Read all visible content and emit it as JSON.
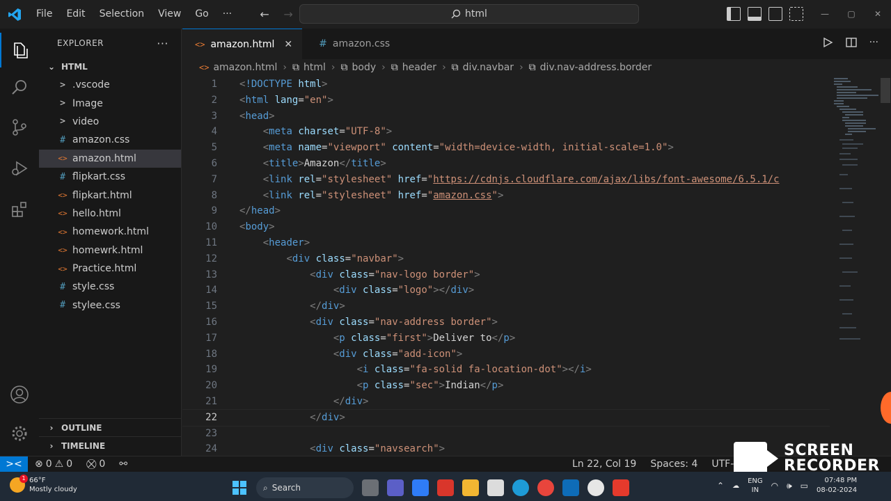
{
  "titlebar": {
    "menu": [
      "File",
      "Edit",
      "Selection",
      "View",
      "Go"
    ],
    "more": "···",
    "command_center": "html"
  },
  "sidebar": {
    "title": "EXPLORER",
    "more": "···",
    "folder": "HTML",
    "items": [
      {
        "label": ".vscode",
        "type": "folder",
        "icon": ">"
      },
      {
        "label": "Image",
        "type": "folder",
        "icon": ">"
      },
      {
        "label": "video",
        "type": "folder",
        "icon": ">"
      },
      {
        "label": "amazon.css",
        "type": "css",
        "icon": "#"
      },
      {
        "label": "amazon.html",
        "type": "html",
        "icon": "<>",
        "selected": true
      },
      {
        "label": "flipkart.css",
        "type": "css",
        "icon": "#"
      },
      {
        "label": "flipkart.html",
        "type": "html",
        "icon": "<>"
      },
      {
        "label": "hello.html",
        "type": "html",
        "icon": "<>"
      },
      {
        "label": "homework.html",
        "type": "html",
        "icon": "<>"
      },
      {
        "label": "homewrk.html",
        "type": "html",
        "icon": "<>"
      },
      {
        "label": "Practice.html",
        "type": "html",
        "icon": "<>"
      },
      {
        "label": "style.css",
        "type": "css",
        "icon": "#"
      },
      {
        "label": "stylee.css",
        "type": "css",
        "icon": "#"
      }
    ],
    "outline": "OUTLINE",
    "timeline": "TIMELINE"
  },
  "tabs": [
    {
      "label": "amazon.html",
      "icon": "<>",
      "active": true,
      "close": "✕"
    },
    {
      "label": "amazon.css",
      "icon": "#",
      "active": false
    }
  ],
  "breadcrumbs": [
    "amazon.html",
    "html",
    "body",
    "header",
    "div.navbar",
    "div.nav-address.border"
  ],
  "code": {
    "current_line": 22,
    "lines": [
      {
        "n": "1",
        "tokens": [
          [
            "p",
            "<"
          ],
          [
            "t",
            "!DOCTYPE"
          ],
          [
            "e",
            " "
          ],
          [
            "a",
            "html"
          ],
          [
            "p",
            ">"
          ]
        ]
      },
      {
        "n": "2",
        "tokens": [
          [
            "p",
            "<"
          ],
          [
            "t",
            "html"
          ],
          [
            "e",
            " "
          ],
          [
            "a",
            "lang"
          ],
          [
            "e",
            "="
          ],
          [
            "s",
            "\"en\""
          ],
          [
            "p",
            ">"
          ]
        ]
      },
      {
        "n": "3",
        "tokens": [
          [
            "p",
            "<"
          ],
          [
            "t",
            "head"
          ],
          [
            "p",
            ">"
          ]
        ]
      },
      {
        "n": "4",
        "indent": "    ",
        "tokens": [
          [
            "p",
            "<"
          ],
          [
            "t",
            "meta"
          ],
          [
            "e",
            " "
          ],
          [
            "a",
            "charset"
          ],
          [
            "e",
            "="
          ],
          [
            "s",
            "\"UTF-8\""
          ],
          [
            "p",
            ">"
          ]
        ]
      },
      {
        "n": "5",
        "indent": "    ",
        "tokens": [
          [
            "p",
            "<"
          ],
          [
            "t",
            "meta"
          ],
          [
            "e",
            " "
          ],
          [
            "a",
            "name"
          ],
          [
            "e",
            "="
          ],
          [
            "s",
            "\"viewport\""
          ],
          [
            "e",
            " "
          ],
          [
            "a",
            "content"
          ],
          [
            "e",
            "="
          ],
          [
            "s",
            "\"width=device-width, initial-scale=1.0\""
          ],
          [
            "p",
            ">"
          ]
        ]
      },
      {
        "n": "6",
        "indent": "    ",
        "tokens": [
          [
            "p",
            "<"
          ],
          [
            "t",
            "title"
          ],
          [
            "p",
            ">"
          ],
          [
            "e",
            "Amazon"
          ],
          [
            "p",
            "</"
          ],
          [
            "t",
            "title"
          ],
          [
            "p",
            ">"
          ]
        ]
      },
      {
        "n": "7",
        "indent": "    ",
        "tokens": [
          [
            "p",
            "<"
          ],
          [
            "t",
            "link"
          ],
          [
            "e",
            " "
          ],
          [
            "a",
            "rel"
          ],
          [
            "e",
            "="
          ],
          [
            "s",
            "\"stylesheet\""
          ],
          [
            "e",
            " "
          ],
          [
            "a",
            "href"
          ],
          [
            "e",
            "="
          ],
          [
            "s",
            "\""
          ],
          [
            "su",
            "https://cdnjs.cloudflare.com/ajax/libs/font-awesome/6.5.1/c"
          ]
        ]
      },
      {
        "n": "8",
        "indent": "    ",
        "tokens": [
          [
            "p",
            "<"
          ],
          [
            "t",
            "link"
          ],
          [
            "e",
            " "
          ],
          [
            "a",
            "rel"
          ],
          [
            "e",
            "="
          ],
          [
            "s",
            "\"stylesheet\""
          ],
          [
            "e",
            " "
          ],
          [
            "a",
            "href"
          ],
          [
            "e",
            "="
          ],
          [
            "s",
            "\""
          ],
          [
            "su",
            "amazon.css"
          ],
          [
            "s",
            "\""
          ],
          [
            "p",
            ">"
          ]
        ]
      },
      {
        "n": "9",
        "tokens": [
          [
            "p",
            "</"
          ],
          [
            "t",
            "head"
          ],
          [
            "p",
            ">"
          ]
        ]
      },
      {
        "n": "10",
        "tokens": [
          [
            "p",
            "<"
          ],
          [
            "t",
            "body"
          ],
          [
            "p",
            ">"
          ]
        ]
      },
      {
        "n": "11",
        "indent": "    ",
        "tokens": [
          [
            "p",
            "<"
          ],
          [
            "t",
            "header"
          ],
          [
            "p",
            ">"
          ]
        ]
      },
      {
        "n": "12",
        "indent": "        ",
        "tokens": [
          [
            "p",
            "<"
          ],
          [
            "t",
            "div"
          ],
          [
            "e",
            " "
          ],
          [
            "a",
            "class"
          ],
          [
            "e",
            "="
          ],
          [
            "s",
            "\"navbar\""
          ],
          [
            "p",
            ">"
          ]
        ]
      },
      {
        "n": "13",
        "indent": "            ",
        "tokens": [
          [
            "p",
            "<"
          ],
          [
            "t",
            "div"
          ],
          [
            "e",
            " "
          ],
          [
            "a",
            "class"
          ],
          [
            "e",
            "="
          ],
          [
            "s",
            "\"nav-logo border\""
          ],
          [
            "p",
            ">"
          ]
        ]
      },
      {
        "n": "14",
        "indent": "                ",
        "tokens": [
          [
            "p",
            "<"
          ],
          [
            "t",
            "div"
          ],
          [
            "e",
            " "
          ],
          [
            "a",
            "class"
          ],
          [
            "e",
            "="
          ],
          [
            "s",
            "\"logo\""
          ],
          [
            "p",
            "></"
          ],
          [
            "t",
            "div"
          ],
          [
            "p",
            ">"
          ]
        ]
      },
      {
        "n": "15",
        "indent": "            ",
        "tokens": [
          [
            "p",
            "</"
          ],
          [
            "t",
            "div"
          ],
          [
            "p",
            ">"
          ]
        ]
      },
      {
        "n": "16",
        "indent": "            ",
        "tokens": [
          [
            "p",
            "<"
          ],
          [
            "t",
            "div"
          ],
          [
            "e",
            " "
          ],
          [
            "a",
            "class"
          ],
          [
            "e",
            "="
          ],
          [
            "s",
            "\"nav-address border\""
          ],
          [
            "p",
            ">"
          ]
        ]
      },
      {
        "n": "17",
        "indent": "                ",
        "tokens": [
          [
            "p",
            "<"
          ],
          [
            "t",
            "p"
          ],
          [
            "e",
            " "
          ],
          [
            "a",
            "class"
          ],
          [
            "e",
            "="
          ],
          [
            "s",
            "\"first\""
          ],
          [
            "p",
            ">"
          ],
          [
            "e",
            "Deliver to"
          ],
          [
            "p",
            "</"
          ],
          [
            "t",
            "p"
          ],
          [
            "p",
            ">"
          ]
        ]
      },
      {
        "n": "18",
        "indent": "                ",
        "tokens": [
          [
            "p",
            "<"
          ],
          [
            "t",
            "div"
          ],
          [
            "e",
            " "
          ],
          [
            "a",
            "class"
          ],
          [
            "e",
            "="
          ],
          [
            "s",
            "\"add-icon\""
          ],
          [
            "p",
            ">"
          ]
        ]
      },
      {
        "n": "19",
        "indent": "                    ",
        "tokens": [
          [
            "p",
            "<"
          ],
          [
            "t",
            "i"
          ],
          [
            "e",
            " "
          ],
          [
            "a",
            "class"
          ],
          [
            "e",
            "="
          ],
          [
            "s",
            "\"fa-solid fa-location-dot\""
          ],
          [
            "p",
            "></"
          ],
          [
            "t",
            "i"
          ],
          [
            "p",
            ">"
          ]
        ]
      },
      {
        "n": "20",
        "indent": "                    ",
        "tokens": [
          [
            "p",
            "<"
          ],
          [
            "t",
            "p"
          ],
          [
            "e",
            " "
          ],
          [
            "a",
            "class"
          ],
          [
            "e",
            "="
          ],
          [
            "s",
            "\"sec\""
          ],
          [
            "p",
            ">"
          ],
          [
            "e",
            "Indian"
          ],
          [
            "p",
            "</"
          ],
          [
            "t",
            "p"
          ],
          [
            "p",
            ">"
          ]
        ]
      },
      {
        "n": "21",
        "indent": "                ",
        "tokens": [
          [
            "p",
            "</"
          ],
          [
            "t",
            "div"
          ],
          [
            "p",
            ">"
          ]
        ]
      },
      {
        "n": "22",
        "indent": "            ",
        "tokens": [
          [
            "p",
            "</"
          ],
          [
            "t",
            "div"
          ],
          [
            "p",
            ">"
          ]
        ]
      },
      {
        "n": "23",
        "tokens": []
      },
      {
        "n": "24",
        "indent": "            ",
        "tokens": [
          [
            "p",
            "<"
          ],
          [
            "t",
            "div"
          ],
          [
            "e",
            " "
          ],
          [
            "a",
            "class"
          ],
          [
            "e",
            "="
          ],
          [
            "s",
            "\"navsearch\""
          ],
          [
            "p",
            ">"
          ]
        ]
      }
    ]
  },
  "statusbar": {
    "remote_icon": "><",
    "errors": "0",
    "warnings": "0",
    "ports": "0",
    "position": "Ln 22, Col 19",
    "spaces": "Spaces: 4",
    "encoding": "UTF-8"
  },
  "recorder": {
    "line1": "SCREEN",
    "line2": "RECORDER"
  },
  "taskbar": {
    "weather_temp": "66°F",
    "weather_desc": "Mostly cloudy",
    "weather_badge": "1",
    "search": "Search",
    "lang1": "ENG",
    "lang2": "IN",
    "time": "07:48 PM",
    "date": "08-02-2024"
  },
  "colors": {
    "accent": "#0078d4",
    "tag": "#569cd6",
    "attribute": "#9cdcfe",
    "string": "#ce9178"
  }
}
